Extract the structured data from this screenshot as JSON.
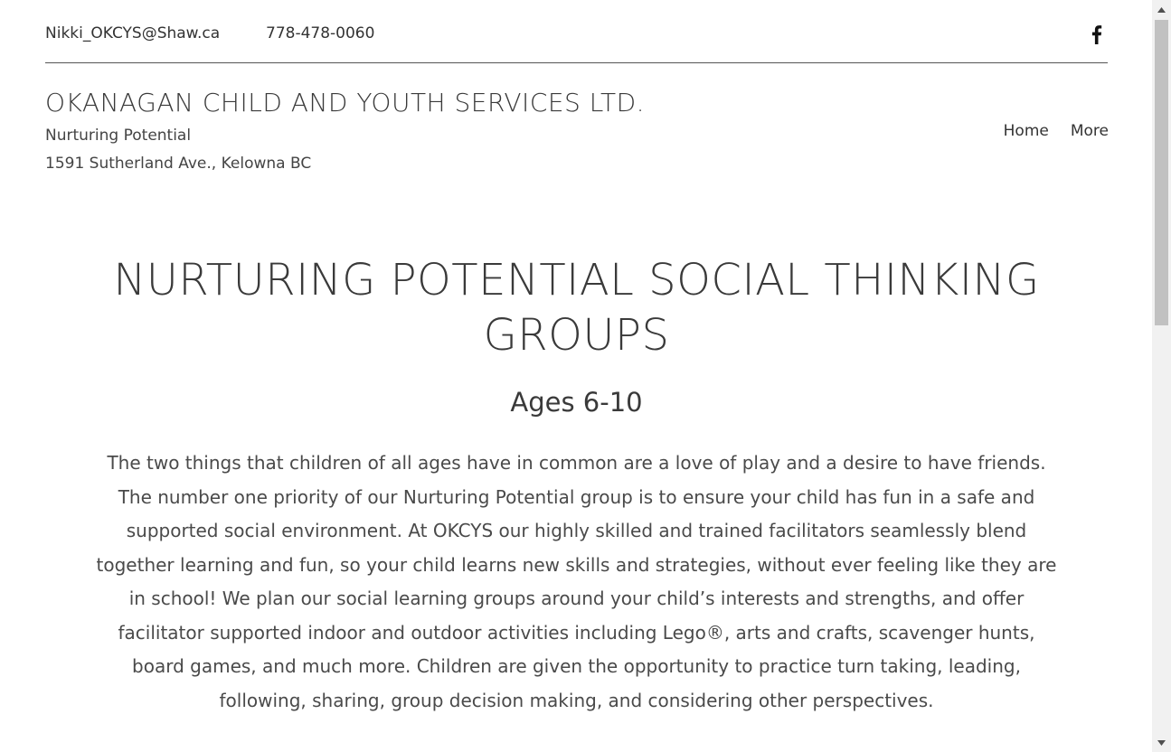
{
  "topbar": {
    "email": "Nikki_OKCYS@Shaw.ca",
    "phone": "778-478-0060",
    "social_icon": "facebook-icon"
  },
  "header": {
    "title": "OKANAGAN CHILD AND YOUTH SERVICES LTD.",
    "tagline": "Nurturing Potential",
    "address": "1591 Sutherland Ave., Kelowna BC"
  },
  "nav": {
    "items": [
      {
        "label": "Home"
      },
      {
        "label": "More"
      }
    ]
  },
  "main": {
    "title": "NURTURING POTENTIAL SOCIAL THINKING GROUPS",
    "subtitle": "Ages 6-10",
    "body": "The two things that children of all ages have in common are a love of play and a desire to have friends.  The number one priority of our Nurturing Potential group is to ensure your child has fun in a safe and supported social environment. At OKCYS our highly skilled and trained facilitators seamlessly blend together learning and fun, so your child learns new skills and strategies, without ever feeling like they are in school! We plan our social learning groups around your child’s interests and strengths, and offer facilitator supported indoor and outdoor activities including Lego®, arts and crafts, scavenger hunts, board games, and much more.  Children are given the opportunity to practice turn taking, leading, following, sharing, group decision making, and considering other perspectives."
  },
  "colors": {
    "text": "#333333",
    "divider": "#555555",
    "scrollbar_track": "#f1f1f1",
    "scrollbar_thumb": "#c1c1c1"
  }
}
